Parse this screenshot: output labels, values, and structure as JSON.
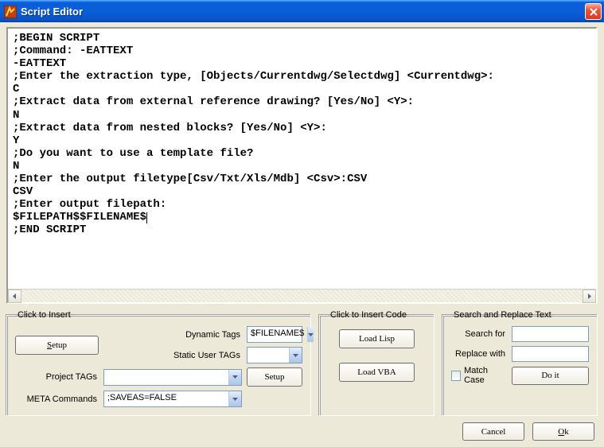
{
  "window": {
    "title": "Script Editor"
  },
  "editor": {
    "lines": [
      ";BEGIN SCRIPT",
      ";Command: -EATTEXT",
      "-EATTEXT",
      ";Enter the extraction type, [Objects/Currentdwg/Selectdwg] <Currentdwg>:",
      "C",
      ";Extract data from external reference drawing? [Yes/No] <Y>:",
      "N",
      ";Extract data from nested blocks? [Yes/No] <Y>:",
      "Y",
      ";Do you want to use a template file?",
      "N",
      ";Enter the output filetype[Csv/Txt/Xls/Mdb] <Csv>:CSV",
      "CSV",
      ";Enter output filepath:",
      "$FILEPATH$$FILENAME$",
      ";END SCRIPT"
    ]
  },
  "insert": {
    "legend": "Click to Insert",
    "rows": {
      "dynamic": {
        "label": "Dynamic Tags",
        "value": "$FILENAME$"
      },
      "static": {
        "label": "Static User TAGs",
        "value": ""
      },
      "project": {
        "label": "Project TAGs",
        "value": ""
      },
      "meta": {
        "label": "META Commands",
        "value": ";SAVEAS=FALSE"
      }
    },
    "setup_label": "Setup"
  },
  "code": {
    "legend": "Click to Insert Code",
    "lisp": "Load Lisp",
    "vba": "Load VBA"
  },
  "search": {
    "legend": "Search and Replace Text",
    "search_for": "Search for",
    "replace_with": "Replace with",
    "match_case": "Match Case",
    "doit": "Do it",
    "search_val": "",
    "replace_val": ""
  },
  "footer": {
    "cancel": "Cancel",
    "ok": "Ok"
  }
}
